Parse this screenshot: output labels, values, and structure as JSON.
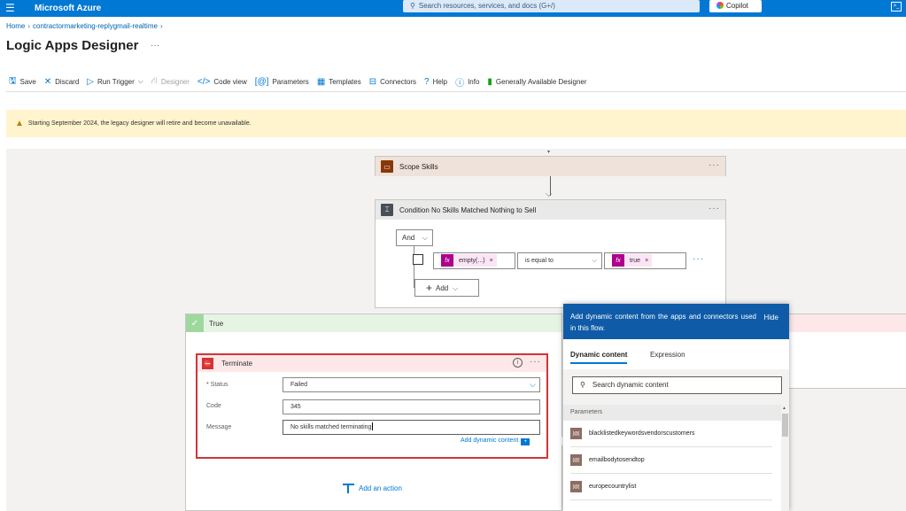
{
  "topbar": {
    "brand": "Microsoft Azure",
    "search_placeholder": "Search resources, services, and docs (G+/)",
    "copilot_label": "Copilot"
  },
  "breadcrumb": {
    "home": "Home",
    "resource": "contractormarketing-replygmail-realtime"
  },
  "page": {
    "title": "Logic Apps Designer",
    "more": "···"
  },
  "toolbar": {
    "save": "Save",
    "discard": "Discard",
    "run_trigger": "Run Trigger",
    "designer": "Designer",
    "code_view": "Code view",
    "parameters": "Parameters",
    "templates": "Templates",
    "connectors": "Connectors",
    "help": "Help",
    "info": "Info",
    "ga_designer": "Generally Available Designer"
  },
  "banner": {
    "text": "Starting September 2024, the legacy designer will retire and become unavailable."
  },
  "scope_card": {
    "title": "Scope Skills"
  },
  "condition_card": {
    "title": "Condition No Skills Matched Nothing to Sell",
    "operator": "And",
    "left_token": "empty(...)",
    "comparator": "is equal to",
    "right_token": "true",
    "add_label": "Add"
  },
  "true_branch": {
    "label": "True"
  },
  "terminate_card": {
    "title": "Terminate",
    "status_label": "Status",
    "status_value": "Failed",
    "code_label": "Code",
    "code_value": "345",
    "message_label": "Message",
    "message_value": "No skills matched terminating",
    "add_dynamic": "Add dynamic content"
  },
  "add_action": "Add an action",
  "dynamic_panel": {
    "header": "Add dynamic content from the apps and connectors used in this flow.",
    "hide": "Hide",
    "tab_dynamic": "Dynamic content",
    "tab_expression": "Expression",
    "search_placeholder": "Search dynamic content",
    "section": "Parameters",
    "items": [
      {
        "name": "blacklistedkeywordsvendorscustomers"
      },
      {
        "name": "emailbodytosendtop"
      },
      {
        "name": "europecountrylist"
      }
    ]
  },
  "colors": {
    "azure_blue": "#0078d4",
    "terminate_red": "#d13438",
    "true_green": "#9fd89f",
    "fx_magenta": "#ad008c",
    "panel_header": "#0f5ba8"
  }
}
